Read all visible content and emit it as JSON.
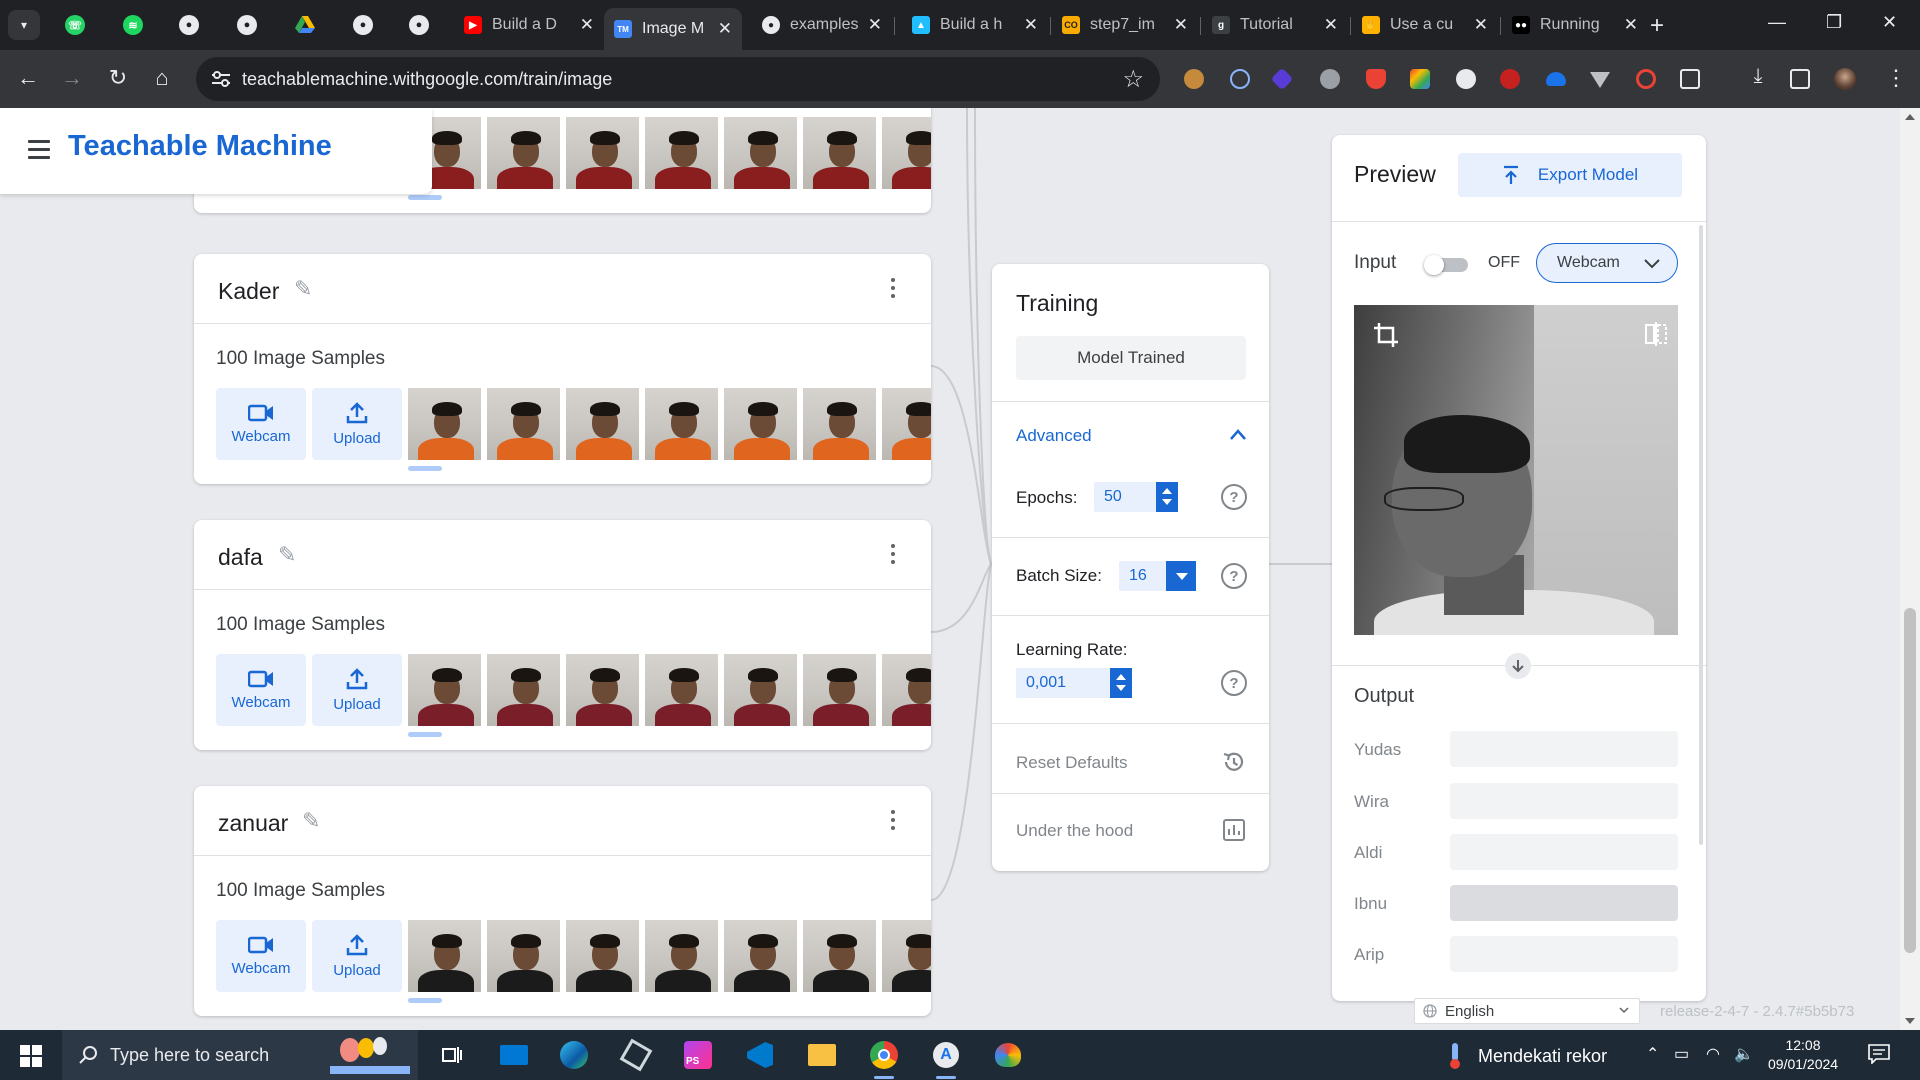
{
  "browser": {
    "tabs": [
      {
        "title": "Build a D",
        "favicon": "youtube-icon"
      },
      {
        "title": "Image M",
        "favicon": "teachable-machine-icon",
        "active": true
      },
      {
        "title": "examples",
        "favicon": "github-icon"
      },
      {
        "title": "Build a h",
        "favicon": "kaggle-icon"
      },
      {
        "title": "step7_im",
        "favicon": "colab-icon"
      },
      {
        "title": "Tutorial",
        "favicon": "g-icon"
      },
      {
        "title": "Use a cu",
        "favicon": "hand-icon"
      },
      {
        "title": "Running",
        "favicon": "medium-icon"
      }
    ],
    "pinned_tabs": [
      "whatsapp-icon",
      "spotify-icon",
      "github-icon",
      "github-icon",
      "google-drive-icon",
      "github-icon",
      "github-icon"
    ],
    "url": "teachablemachine.withgoogle.com/train/image"
  },
  "app": {
    "title": "Teachable Machine"
  },
  "classes": [
    {
      "name": "",
      "samples": "",
      "shirt": "#8a1e1e"
    },
    {
      "name": "Kader",
      "samples": "100 Image Samples",
      "webcam": "Webcam",
      "upload": "Upload",
      "shirt": "#e0651f"
    },
    {
      "name": "dafa",
      "samples": "100 Image Samples",
      "webcam": "Webcam",
      "upload": "Upload",
      "shirt": "#7a1f2a"
    },
    {
      "name": "zanuar",
      "samples": "100 Image Samples",
      "webcam": "Webcam",
      "upload": "Upload",
      "shirt": "#1b1b1b"
    }
  ],
  "training": {
    "title": "Training",
    "button": "Model Trained",
    "advanced": "Advanced",
    "epochs_label": "Epochs:",
    "epochs_value": "50",
    "batch_label": "Batch Size:",
    "batch_value": "16",
    "lr_label": "Learning Rate:",
    "lr_value": "0,001",
    "reset": "Reset Defaults",
    "under_hood": "Under the hood"
  },
  "preview": {
    "title": "Preview",
    "export": "Export Model",
    "input_label": "Input",
    "toggle_state": "OFF",
    "source": "Webcam",
    "output_label": "Output",
    "outputs": [
      "Yudas",
      "Wira",
      "Aldi",
      "Ibnu",
      "Arip"
    ]
  },
  "footer": {
    "language": "English",
    "release": "release-2-4-7 - 2.4.7#5b5b73"
  },
  "taskbar": {
    "search_placeholder": "Type here to search",
    "weather": "Mendekati rekor",
    "time": "12:08",
    "date": "09/01/2024"
  },
  "colors": {
    "brand_blue": "#1967d2",
    "light_blue": "#e8f0fe"
  }
}
